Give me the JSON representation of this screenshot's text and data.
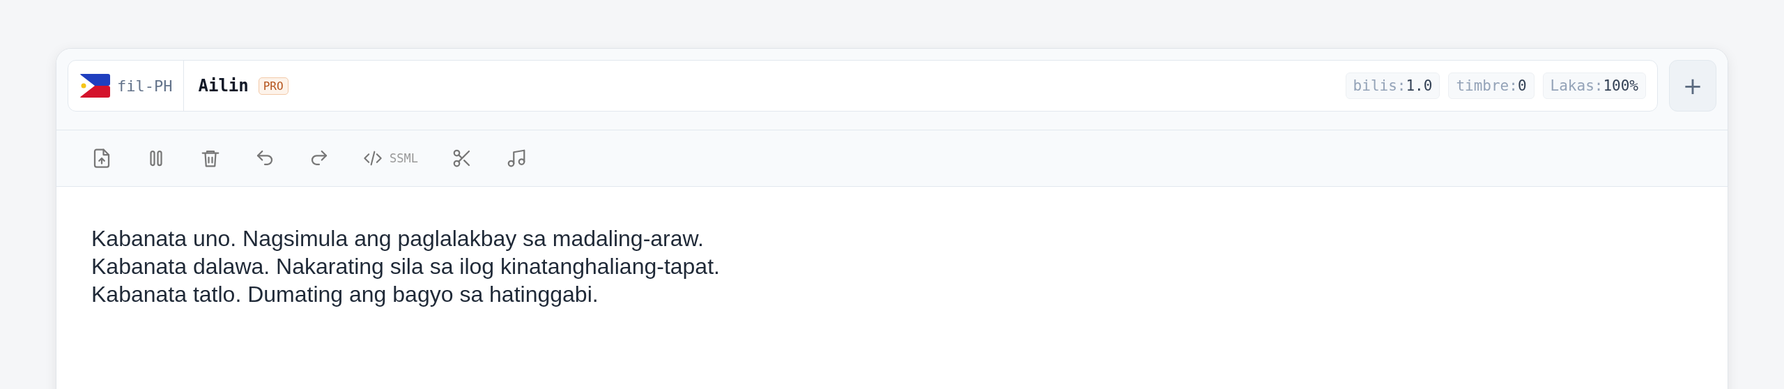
{
  "voice": {
    "locale": "fil-PH",
    "name": "Ailin",
    "badge": "PRO"
  },
  "params": [
    {
      "label": "bilis:",
      "value": "1.0"
    },
    {
      "label": "timbre:",
      "value": "0"
    },
    {
      "label": "Lakas:",
      "value": "100%"
    }
  ],
  "add_button": "+",
  "toolbar": [
    {
      "kind": "upload"
    },
    {
      "kind": "pause"
    },
    {
      "kind": "delete"
    },
    {
      "kind": "undo"
    },
    {
      "kind": "redo"
    },
    {
      "kind": "ssml",
      "label": "SSML"
    },
    {
      "kind": "cut"
    },
    {
      "kind": "music"
    }
  ],
  "editor": {
    "lines": [
      "Kabanata uno. Nagsimula ang paglalakbay sa madaling-araw.",
      "Kabanata dalawa. Nakarating sila sa ilog kinatanghaliang-tapat.",
      "Kabanata tatlo. Dumating ang bagyo sa hatinggabi."
    ]
  }
}
